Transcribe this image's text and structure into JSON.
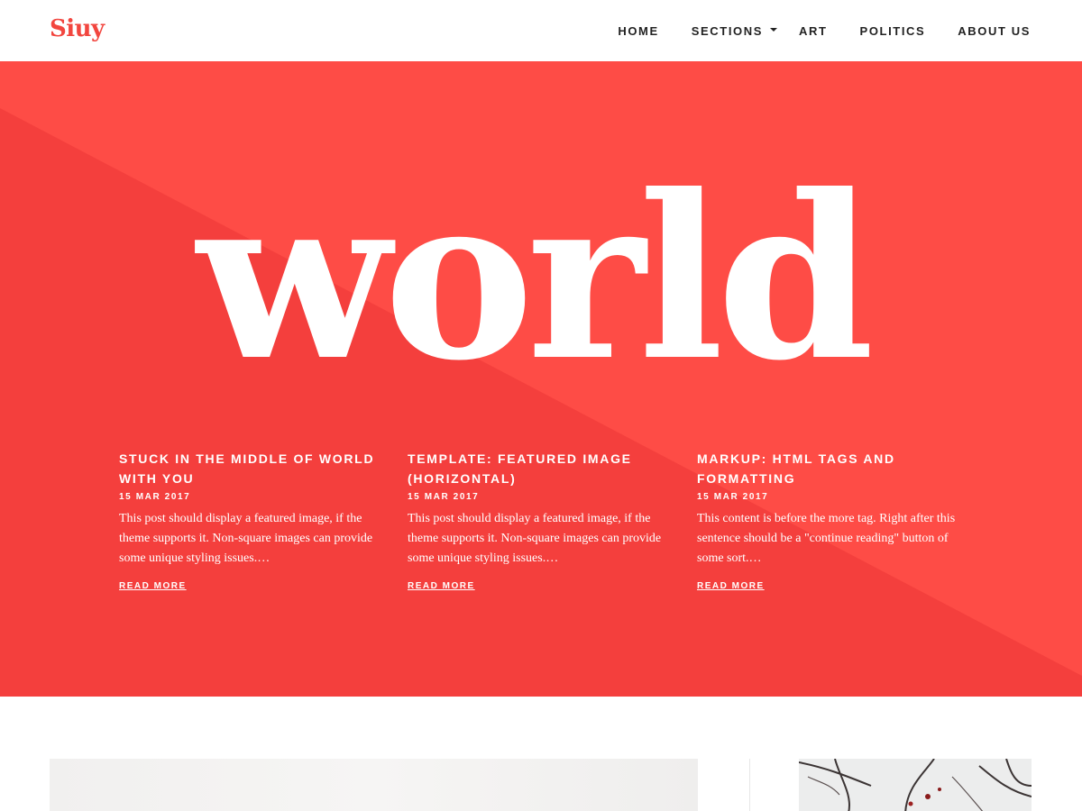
{
  "site": {
    "logo": "Siuy",
    "brand_color": "#f2463f"
  },
  "nav": {
    "items": [
      {
        "label": "HOME"
      },
      {
        "label": "SECTIONS",
        "has_dropdown": true
      },
      {
        "label": "ART"
      },
      {
        "label": "POLITICS"
      },
      {
        "label": "ABOUT US"
      }
    ]
  },
  "hero": {
    "word": "world",
    "background": "#fe4c46",
    "shade": "#f43f3d",
    "posts": [
      {
        "title": "STUCK IN THE MIDDLE OF WORLD WITH YOU",
        "date": "15 MAR 2017",
        "excerpt": "This post should display a featured image, if the theme supports it. Non-square images can provide some unique styling issues.…",
        "read_more": "READ MORE"
      },
      {
        "title": "TEMPLATE: FEATURED IMAGE (HORIZONTAL)",
        "date": "15 MAR 2017",
        "excerpt": "This post should display a featured image, if the theme supports it. Non-square images can provide some unique styling issues.…",
        "read_more": "READ MORE"
      },
      {
        "title": "MARKUP: HTML TAGS AND FORMATTING",
        "date": "15 MAR 2017",
        "excerpt": "This content is before the more tag. Right after this sentence should be a \"continue reading\" button of some sort.…",
        "read_more": "READ MORE"
      }
    ]
  }
}
